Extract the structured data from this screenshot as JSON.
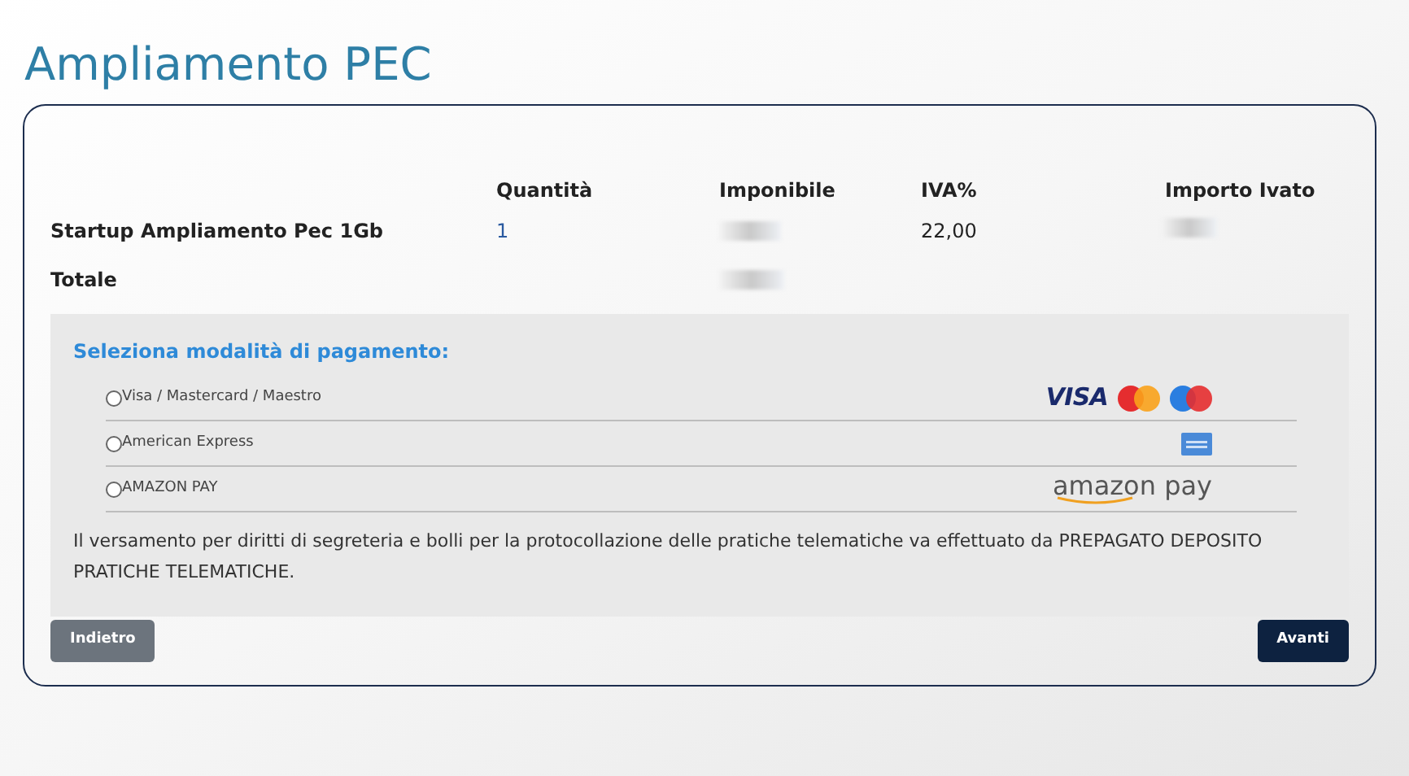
{
  "page_title": "Ampliamento PEC",
  "table": {
    "columns": [
      "Quantità",
      "Imponibile",
      "IVA%",
      "Importo Ivato"
    ],
    "rows": [
      {
        "label": "Startup Ampliamento Pec 1Gb",
        "quantity": "1",
        "vat": "22,00"
      },
      {
        "label": "Totale"
      }
    ]
  },
  "payment": {
    "title": "Seleziona modalità di pagamento:",
    "methods": [
      {
        "label": "Visa / Mastercard / Maestro",
        "selected": false,
        "kind": "cards",
        "logo_text": "VISA"
      },
      {
        "label": "American Express",
        "selected": false,
        "kind": "amex"
      },
      {
        "label": "AMAZON PAY",
        "selected": false,
        "kind": "amazon",
        "logo_text": "amazon pay"
      }
    ],
    "note": "Il versamento per diritti di segreteria e bolli per la protocollazione delle pratiche telematiche va effettuato da PREPAGATO DEPOSITO PRATICHE TELEMATICHE."
  },
  "buttons": [
    {
      "label": "Indietro",
      "kind": "secondary"
    },
    {
      "label": "Avanti",
      "kind": "primary"
    }
  ]
}
